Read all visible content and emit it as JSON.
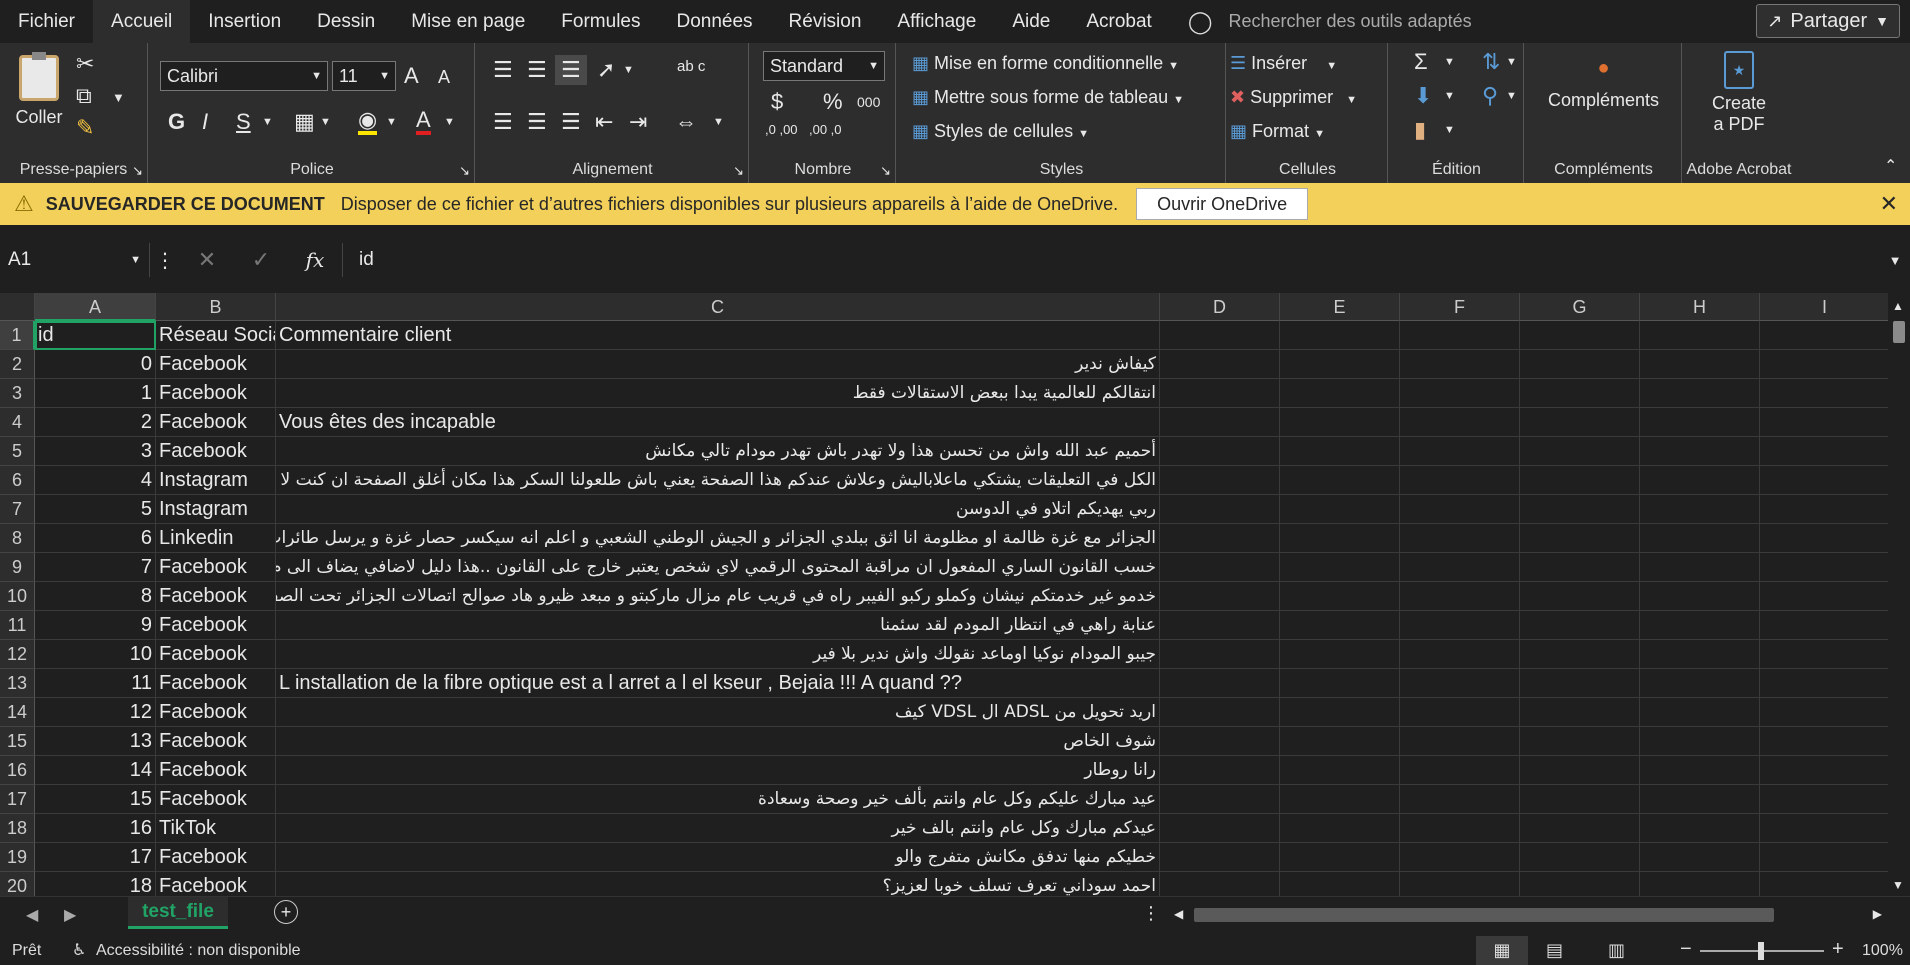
{
  "menu": {
    "tabs": [
      "Fichier",
      "Accueil",
      "Insertion",
      "Dessin",
      "Mise en page",
      "Formules",
      "Données",
      "Révision",
      "Affichage",
      "Aide",
      "Acrobat"
    ],
    "active_tab": "Accueil",
    "search_placeholder": "Rechercher des outils adaptés",
    "share_label": "Partager"
  },
  "ribbon": {
    "clipboard": {
      "paste": "Coller",
      "label": "Presse-papiers"
    },
    "font": {
      "name": "Calibri",
      "size": "11",
      "bold": "G",
      "italic": "I",
      "underline": "S",
      "grow": "A",
      "shrink": "A",
      "label": "Police"
    },
    "alignment": {
      "label": "Alignement",
      "wrap": "ab c"
    },
    "number": {
      "format": "Standard",
      "currency": "$",
      "percent": "%",
      "thousands": "000",
      "dec_inc": ",0 ,00",
      "dec_dec": ",00 ,0",
      "label": "Nombre"
    },
    "styles": {
      "conditional": "Mise en forme conditionnelle",
      "table": "Mettre sous forme de tableau",
      "cell_styles": "Styles de cellules",
      "label": "Styles"
    },
    "cells": {
      "insert": "Insérer",
      "delete": "Supprimer",
      "format": "Format",
      "label": "Cellules"
    },
    "editing": {
      "label": "Édition"
    },
    "addins": {
      "button": "Compléments",
      "label": "Compléments"
    },
    "acrobat": {
      "button_line1": "Create",
      "button_line2": "a PDF",
      "label": "Adobe Acrobat"
    }
  },
  "notification": {
    "title": "SAUVEGARDER CE DOCUMENT",
    "message": "Disposer de ce fichier et d’autres fichiers disponibles sur plusieurs appareils à l’aide de OneDrive.",
    "button": "Ouvrir OneDrive"
  },
  "formula_bar": {
    "cell_ref": "A1",
    "content": "id",
    "fx": "fx"
  },
  "columns": [
    "A",
    "B",
    "C",
    "D",
    "E",
    "F",
    "G",
    "H",
    "I"
  ],
  "rows": [
    {
      "n": "1",
      "a": "id",
      "b": "Réseau Socia",
      "c": "Commentaire client",
      "rtl": false,
      "header": true
    },
    {
      "n": "2",
      "a": "0",
      "b": "Facebook",
      "c": "كيفاش ندير",
      "rtl": true
    },
    {
      "n": "3",
      "a": "1",
      "b": "Facebook",
      "c": "انتقالكم للعالمية يبدا ببعض الاستقالات فقط",
      "rtl": true
    },
    {
      "n": "4",
      "a": "2",
      "b": "Facebook",
      "c": "Vous êtes des incapable",
      "rtl": false
    },
    {
      "n": "5",
      "a": "3",
      "b": "Facebook",
      "c": "أحميم عبد الله واش من تحسن هذا ولا تهدر باش تهدر مودام تالي مكانش",
      "rtl": true
    },
    {
      "n": "6",
      "a": "4",
      "b": "Instagram",
      "c": "الكل في التعليقات يشتكي ماعلاباليش وعلاش عندكم هذا الصفحة يعني باش طلعولنا السكر هذا مكان أغلق الصفحة ان كنت لا",
      "rtl": true
    },
    {
      "n": "7",
      "a": "5",
      "b": "Instagram",
      "c": "ربي يهديكم اتلاو في الدوسن",
      "rtl": true
    },
    {
      "n": "8",
      "a": "6",
      "b": "Linkedin",
      "c": "الجزائر مع غزة ظالمة او مظلومة انا اثق ببلدي الجزائر و الجيش الوطني الشعبي و اعلم انه سيكسر حصار غزة و يرسل طائرات م",
      "rtl": true
    },
    {
      "n": "9",
      "a": "7",
      "b": "Facebook",
      "c": "خسب القانون الساري المفعول ان مراقبة المحتوى الرقمي لاي شخص يعتبر خارج على القانون ..هذا دليل لاضافي يضاف الى م",
      "rtl": true
    },
    {
      "n": "10",
      "a": "8",
      "b": "Facebook",
      "c": "خدمو غير خدمتكم نيشان وكملو ركبو الفيبر راه في قريب عام مزال ماركبتو و مبعد ظيرو هاد صوالح اتصالات الجزائر تحت الصف",
      "rtl": true
    },
    {
      "n": "11",
      "a": "9",
      "b": "Facebook",
      "c": "عنابة راهي في انتظار المودم لقد سئمنا",
      "rtl": true
    },
    {
      "n": "12",
      "a": "10",
      "b": "Facebook",
      "c": "جيبو المودام نوكيا اوماعد نقولك واش ندير بلا فير",
      "rtl": true
    },
    {
      "n": "13",
      "a": "11",
      "b": "Facebook",
      "c": "L installation de la fibre optique est a l arret a l el kseur , Bejaia !!! A quand ??",
      "rtl": false
    },
    {
      "n": "14",
      "a": "12",
      "b": "Facebook",
      "c": "اريد تحويل من ADSL ال VDSL كيف",
      "rtl": true
    },
    {
      "n": "15",
      "a": "13",
      "b": "Facebook",
      "c": "شوف الخاص",
      "rtl": true
    },
    {
      "n": "16",
      "a": "14",
      "b": "Facebook",
      "c": "رانا روطار",
      "rtl": true
    },
    {
      "n": "17",
      "a": "15",
      "b": "Facebook",
      "c": "عيد مبارك عليكم وكل عام وانتم بألف خير وصحة وسعادة",
      "rtl": true
    },
    {
      "n": "18",
      "a": "16",
      "b": "TikTok",
      "c": "عيدكم مبارك وكل عام وانتم بالف خير",
      "rtl": true
    },
    {
      "n": "19",
      "a": "17",
      "b": "Facebook",
      "c": "خطيكم منها تدفق مكانش متفرج والو",
      "rtl": true
    },
    {
      "n": "20",
      "a": "18",
      "b": "Facebook",
      "c": "احمد سوداني تعرف تسلف خوبا لعزيز؟",
      "rtl": true
    }
  ],
  "sheet_tab": "test_file",
  "status": {
    "ready": "Prêt",
    "accessibility": "Accessibilité : non disponible",
    "zoom": "100%"
  },
  "colors": {
    "accent_green": "#21a366",
    "notification_bg": "#f3d05a",
    "ribbon_bg": "#2d2d2d",
    "window_bg": "#1f1f1f"
  }
}
